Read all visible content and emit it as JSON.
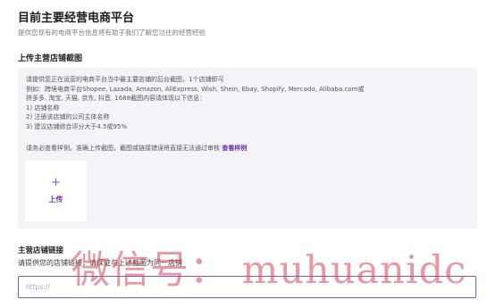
{
  "page": {
    "title": "目前主要经营电商平台",
    "subtitle": "提供您现有的电商平台信息将有助于我们了解您过往的经营经验"
  },
  "screenshot_section": {
    "title": "上传主营店铺截图",
    "info_lines": [
      "请提供您正在运营的电商平台当中最主要店铺的后台截图，1个店铺即可",
      "例如：跨境电商平台Shopee, Lazada, Amazon, AliExpress, Wish, Shein, Ebay, Shopify, Mercado, Alibaba.com或",
      "拼多多, 淘宝, 天猫, 京东, 抖音, 1688截图内容请体现以下信息：",
      "1) 店铺名称",
      "2) 注册该店铺的公司主体名称",
      "3) 建议店铺综合评分大于4.5或95%"
    ],
    "note": "请务必查看样例，准确上传截图，截图或链接错误将直接无法通过审核",
    "sample_link": "查看样例",
    "upload": {
      "plus": "+",
      "label": "上传"
    }
  },
  "link_section": {
    "title": "主营店铺链接",
    "subtitle": "请提供您的店铺链接，请保证与上述截图为同一店铺",
    "input": {
      "placeholder": "https://",
      "value": ""
    }
  },
  "watermark": "微信号： muhuanidc",
  "colors": {
    "accent": "#6a2ea8",
    "panel": "#f3f3f8",
    "watermark": "#d64652"
  }
}
